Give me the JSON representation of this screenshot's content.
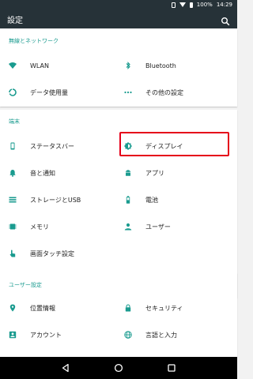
{
  "statusbar": {
    "battery": "100%",
    "time": "14:29"
  },
  "appbar": {
    "title": "設定",
    "search_icon": "search-icon"
  },
  "sections": {
    "wireless": {
      "header": "無線とネットワーク",
      "items": [
        {
          "label": "WLAN",
          "icon": "wifi-icon"
        },
        {
          "label": "Bluetooth",
          "icon": "bluetooth-icon"
        },
        {
          "label": "データ使用量",
          "icon": "data-usage-icon"
        },
        {
          "label": "その他の設定",
          "icon": "more-icon"
        }
      ]
    },
    "device": {
      "header": "端末",
      "items": [
        {
          "label": "ステータスバー",
          "icon": "phone-icon"
        },
        {
          "label": "ディスプレイ",
          "icon": "brightness-icon"
        },
        {
          "label": "音と通知",
          "icon": "bell-icon"
        },
        {
          "label": "アプリ",
          "icon": "android-icon"
        },
        {
          "label": "ストレージとUSB",
          "icon": "storage-icon"
        },
        {
          "label": "電池",
          "icon": "battery-icon"
        },
        {
          "label": "メモリ",
          "icon": "memory-icon"
        },
        {
          "label": "ユーザー",
          "icon": "person-icon"
        },
        {
          "label": "画面タッチ設定",
          "icon": "touch-icon"
        }
      ]
    },
    "personal": {
      "header": "ユーザー設定",
      "items": [
        {
          "label": "位置情報",
          "icon": "location-icon"
        },
        {
          "label": "セキュリティ",
          "icon": "lock-icon"
        },
        {
          "label": "アカウント",
          "icon": "account-icon"
        },
        {
          "label": "言語と入力",
          "icon": "globe-icon"
        }
      ]
    }
  },
  "colors": {
    "accent": "#1a9b8f",
    "appbar": "#263238",
    "highlight": "#e5001a"
  },
  "navbar": {
    "back_icon": "back-icon",
    "home_icon": "home-icon",
    "recents_icon": "recents-icon"
  }
}
